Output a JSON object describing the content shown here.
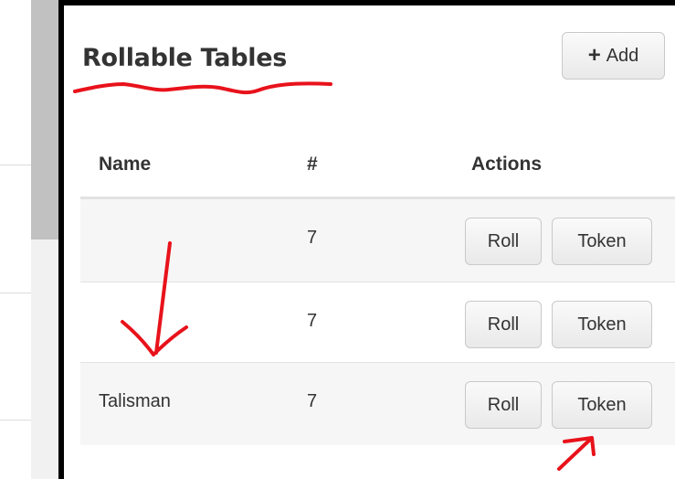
{
  "page": {
    "title": "Rollable Tables"
  },
  "toolbar": {
    "add_label": "Add",
    "add_icon": "plus-icon"
  },
  "table": {
    "headers": {
      "name": "Name",
      "count": "#",
      "actions": "Actions"
    },
    "rows": [
      {
        "name": "",
        "count": "7",
        "roll_label": "Roll",
        "token_label": "Token"
      },
      {
        "name": "",
        "count": "7",
        "roll_label": "Roll",
        "token_label": "Token"
      },
      {
        "name": "Talisman",
        "count": "7",
        "roll_label": "Roll",
        "token_label": "Token"
      }
    ]
  },
  "colors": {
    "annotation": "#e8121b",
    "text": "#333333",
    "background": "#ffffff"
  }
}
